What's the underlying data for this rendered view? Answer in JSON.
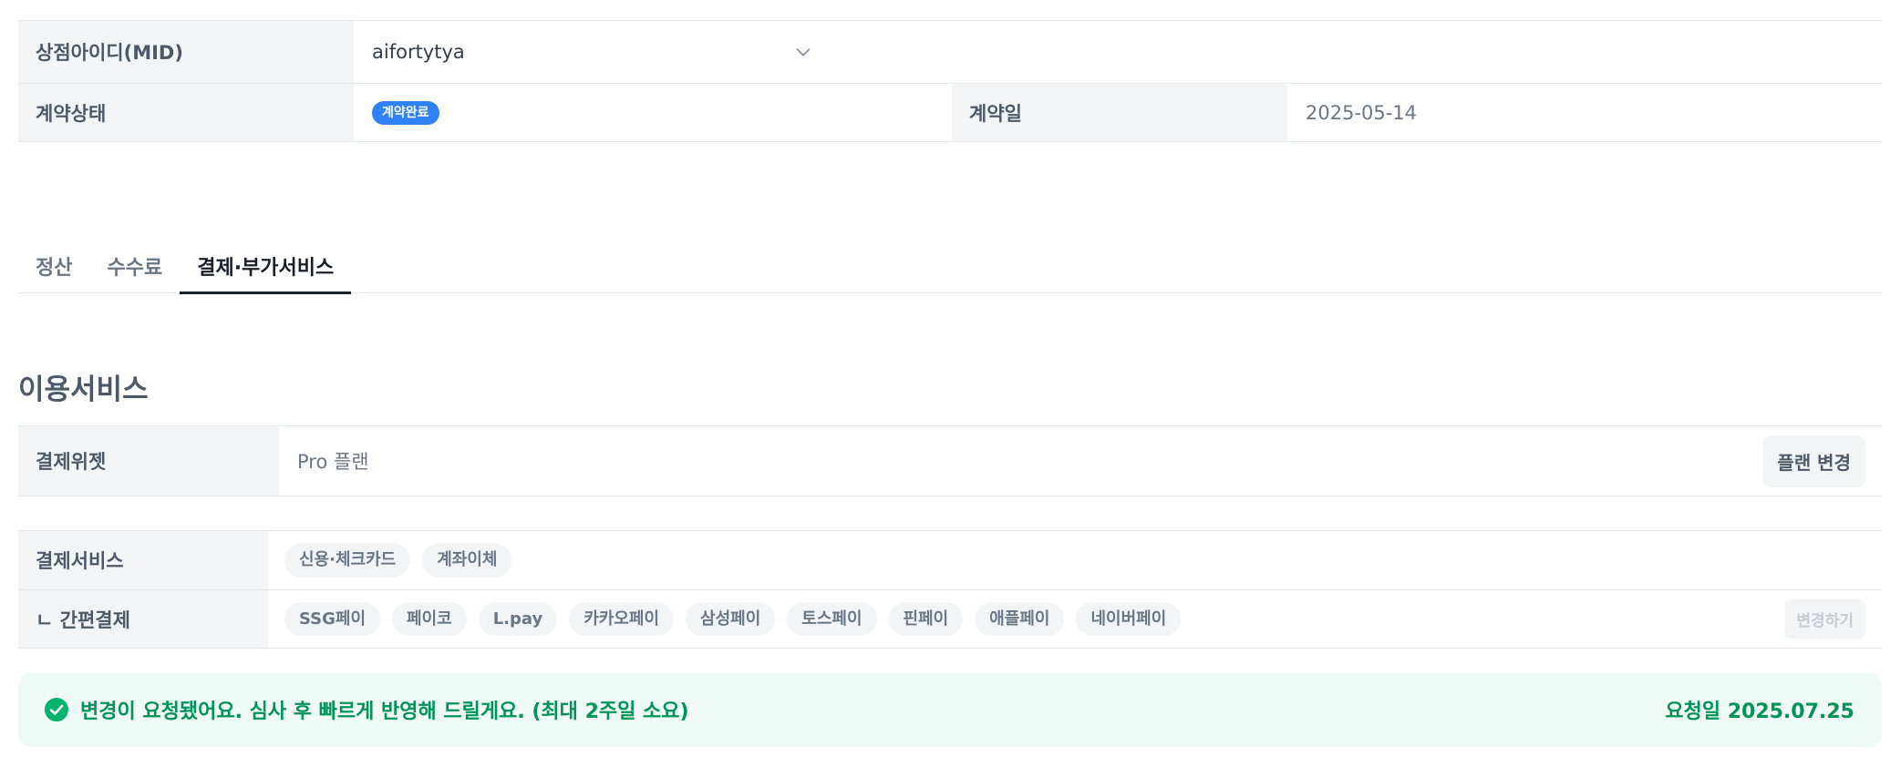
{
  "info": {
    "mid_label": "상점아이디(MID)",
    "mid_value": "aifortytya",
    "status_label": "계약상태",
    "status_badge": "계약완료",
    "date_label": "계약일",
    "date_value": "2025-05-14"
  },
  "tabs": [
    {
      "label": "정산",
      "active": false
    },
    {
      "label": "수수료",
      "active": false
    },
    {
      "label": "결제·부가서비스",
      "active": true
    }
  ],
  "section_title": "이용서비스",
  "widget": {
    "label": "결제위젯",
    "plan": "Pro 플랜",
    "change_plan_button": "플랜 변경"
  },
  "payment": {
    "service_label": "결제서비스",
    "services": [
      "신용·체크카드",
      "계좌이체"
    ],
    "easy_label": "ㄴ 간편결제",
    "easy_pays": [
      "SSG페이",
      "페이코",
      "L.pay",
      "카카오페이",
      "삼성페이",
      "토스페이",
      "핀페이",
      "애플페이",
      "네이버페이"
    ],
    "change_button": "변경하기"
  },
  "notice": {
    "message": "변경이 요청됐어요. 심사 후 빠르게 반영해 드릴게요. (최대 2주일 소요)",
    "request_date": "요청일 2025.07.25"
  },
  "colors": {
    "accent_blue": "#3182f6",
    "success_green": "#029359",
    "notice_bg": "#f0faf6",
    "label_bg": "#f2f4f6"
  },
  "icons": {
    "select": "chevron-down-icon",
    "notice": "check-circle-icon"
  }
}
